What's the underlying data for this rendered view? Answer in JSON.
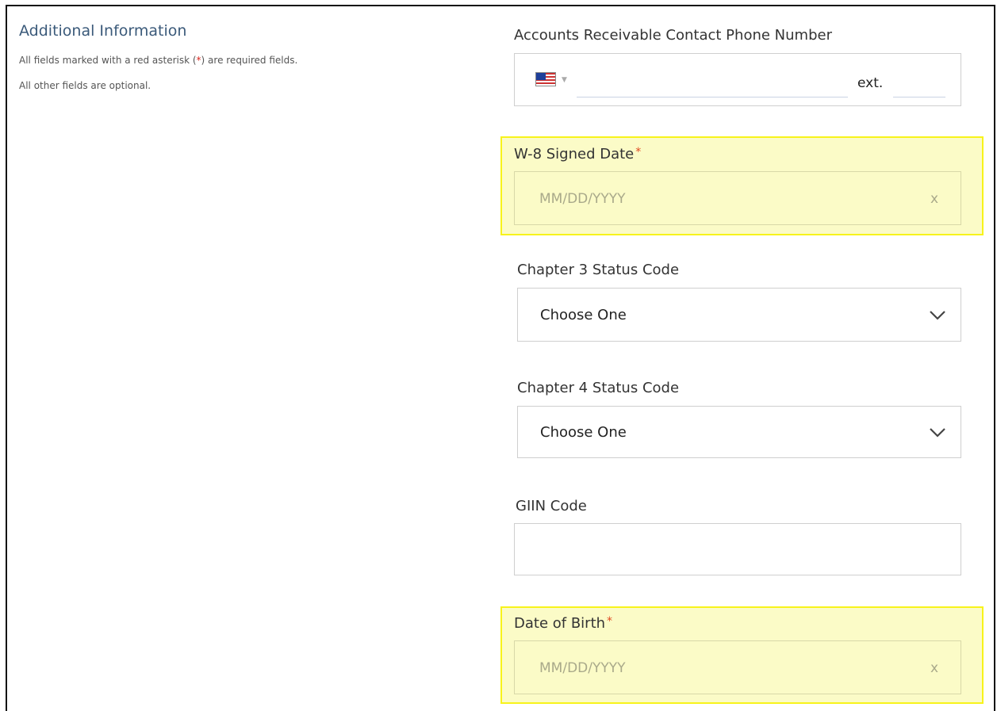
{
  "left": {
    "title": "Additional Information",
    "note_prefix": "All fields marked with a red asterisk (",
    "note_star": "*",
    "note_suffix": ") are required fields.",
    "note_optional": "All other fields are optional."
  },
  "fields": {
    "phone": {
      "label": "Accounts Receivable Contact Phone Number",
      "ext_label": "ext.",
      "number_value": "",
      "ext_value": ""
    },
    "w8_date": {
      "label": "W-8 Signed Date",
      "required_mark": "*",
      "placeholder": "MM/DD/YYYY",
      "clear": "x"
    },
    "chapter3": {
      "label": "Chapter 3 Status Code",
      "selected": "Choose One"
    },
    "chapter4": {
      "label": "Chapter 4 Status Code",
      "selected": "Choose One"
    },
    "giin": {
      "label": "GIIN Code",
      "value": ""
    },
    "dob": {
      "label": "Date of Birth",
      "required_mark": "*",
      "placeholder": "MM/DD/YYYY",
      "clear": "x"
    }
  },
  "colors": {
    "highlight_fill": "#fbfbc7",
    "highlight_border": "#f7f31b",
    "required": "#e04a22",
    "title": "#3b5a7a"
  },
  "icons": {
    "flag": "us-flag-icon",
    "dropdown": "chevron-down-icon"
  }
}
